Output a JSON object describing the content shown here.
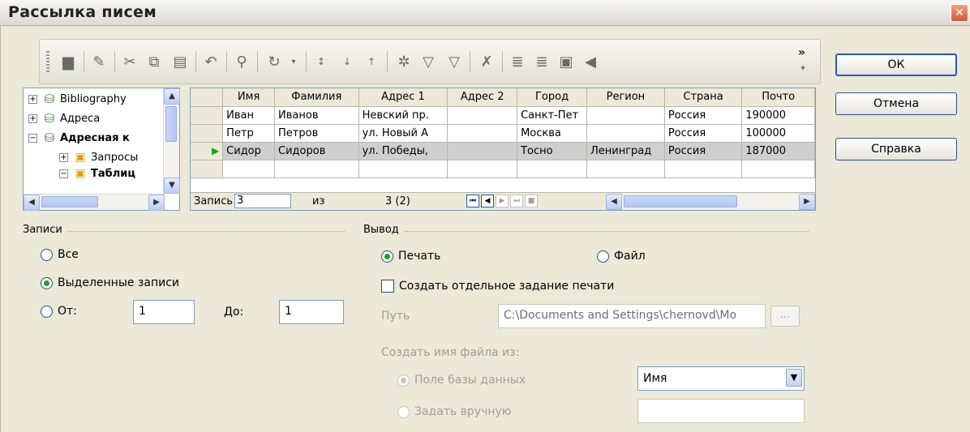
{
  "window": {
    "title": "Рассылка писем",
    "close_label": "✕"
  },
  "buttons": {
    "ok": "ОК",
    "cancel": "Отмена",
    "help": "Справка"
  },
  "toolbar": {
    "more": "»"
  },
  "tree": {
    "items": [
      {
        "label": "Bibliography",
        "expander": "+",
        "bold": false
      },
      {
        "label": "Адреса",
        "expander": "+",
        "bold": false
      },
      {
        "label": "Адресная к",
        "expander": "−",
        "bold": true
      },
      {
        "label": "Запросы",
        "expander": "+",
        "bold": false
      },
      {
        "label": "Таблиц",
        "expander": "−",
        "bold": true
      }
    ]
  },
  "grid": {
    "columns": [
      "Имя",
      "Фамилия",
      "Адрес 1",
      "Адрес 2",
      "Город",
      "Регион",
      "Страна",
      "Почто"
    ],
    "rows": [
      [
        "Иван",
        "Иванов",
        "Невский пр.",
        "",
        "Санкт-Пет",
        "",
        "Россия",
        "190000"
      ],
      [
        "Петр",
        "Петров",
        "ул. Новый А",
        "",
        "Москва",
        "",
        "Россия",
        "100000"
      ],
      [
        "Сидор",
        "Сидоров",
        "ул. Победы,",
        "",
        "Тосно",
        "Ленинград",
        "Россия",
        "187000"
      ]
    ],
    "selected_row": 2,
    "nav": {
      "record_label": "Запись",
      "record_value": "3",
      "of_label": "из",
      "count": "3 (2)"
    }
  },
  "records": {
    "title": "Записи",
    "all": "Все",
    "selected": "Выделенные записи",
    "from": "От:",
    "from_value": "1",
    "to": "До:",
    "to_value": "1",
    "checked": "selected"
  },
  "output": {
    "title": "Вывод",
    "print": "Печать",
    "file": "Файл",
    "separate_job": "Создать отдельное задание печати",
    "path_label": "Путь",
    "path_value": "C:\\Documents and Settings\\chernovd\\Mo",
    "browse": "...",
    "filename_from": "Создать имя файла из:",
    "db_field": "Поле базы данных",
    "db_field_value": "Имя",
    "manual": "Задать вручную"
  }
}
